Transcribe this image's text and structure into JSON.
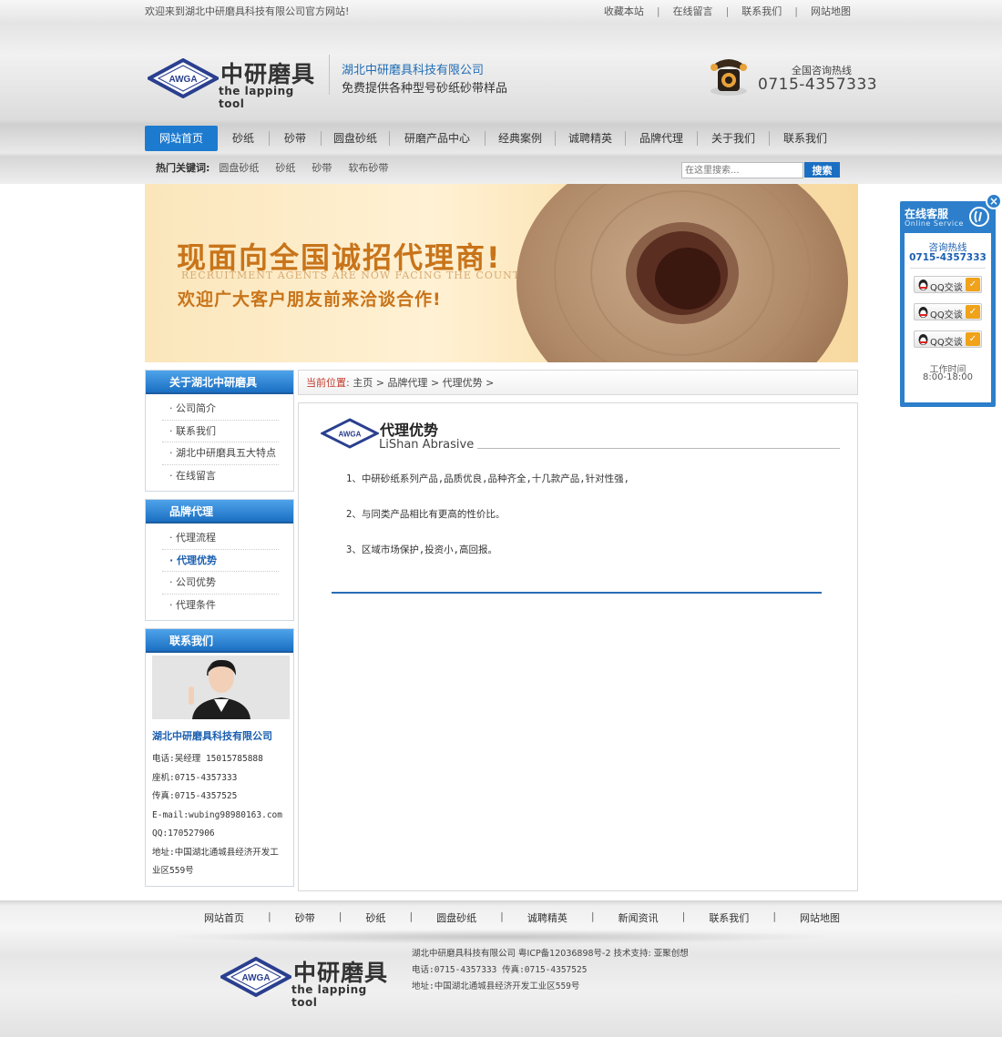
{
  "topbar": {
    "welcome": "欢迎来到湖北中研磨具科技有限公司官方网站!",
    "links": [
      "收藏本站",
      "在线留言",
      "联系我们",
      "网站地图"
    ]
  },
  "header": {
    "logo_badge": "AWGA",
    "logo_cn": "中研磨具",
    "logo_en": "the lapping tool",
    "company_name": "湖北中研磨具科技有限公司",
    "slogan": "免费提供各种型号砂纸砂带样品",
    "hotline_label": "全国咨询热线",
    "hotline_number": "0715-4357333"
  },
  "nav": {
    "items": [
      "网站首页",
      "砂纸",
      "砂带",
      "圆盘砂纸",
      "研磨产品中心",
      "经典案例",
      "诚聘精英",
      "品牌代理",
      "关于我们",
      "联系我们"
    ],
    "active_index": 0
  },
  "hotbar": {
    "label": "热门关键词:",
    "keywords": [
      "圆盘砂纸",
      "砂纸",
      "砂带",
      "软布砂带"
    ]
  },
  "search": {
    "placeholder": "在这里搜索...",
    "button": "搜索"
  },
  "banner": {
    "title": "现面向全国诚招代理商!",
    "english": "RECRUITMENT AGENTS ARE NOW FACING THE COUNTRY",
    "subtitle": "欢迎广大客户朋友前来洽谈合作!"
  },
  "sidebar": {
    "about": {
      "title": "关于湖北中研磨具",
      "items": [
        "公司简介",
        "联系我们",
        "湖北中研磨具五大特点",
        "在线留言"
      ]
    },
    "brand": {
      "title": "品牌代理",
      "items": [
        "代理流程",
        "代理优势",
        "公司优势",
        "代理条件"
      ],
      "active_index": 1
    },
    "contact": {
      "title": "联系我们",
      "company": "湖北中研磨具科技有限公司",
      "lines": [
        "电话:吴经理 15015785888",
        "座机:0715-4357333",
        "传真:0715-4357525",
        "E-mail:wubing98980163.com",
        "QQ:170527906",
        "地址:中国湖北通城县经济开发工",
        "业区559号"
      ]
    }
  },
  "breadcrumb": {
    "label": "当前位置:",
    "items": [
      "主页",
      "品牌代理",
      "代理优势"
    ]
  },
  "article": {
    "title": "代理优势",
    "subtitle": "LiShan Abrasive",
    "paragraphs": [
      "1、中研砂纸系列产品,品质优良,品种齐全,十几款产品,针对性强,",
      "2、与同类产品相比有更高的性价比。",
      "3、区域市场保护,投资小,高回报。"
    ]
  },
  "service": {
    "title": "在线客服",
    "title_en": "Online Service",
    "close": "×",
    "hotline_label": "咨询热线",
    "hotline": "0715-4357333",
    "qq_buttons": [
      "QQ交谈",
      "QQ交谈",
      "QQ交谈"
    ],
    "time_label": "工作时间",
    "time": "8:00-18:00"
  },
  "footer": {
    "nav": [
      "网站首页",
      "砂带",
      "砂纸",
      "圆盘砂纸",
      "诚聘精英",
      "新闻资讯",
      "联系我们",
      "网站地图"
    ],
    "company_line": "湖北中研磨具科技有限公司 粤ICP备12036898号-2 技术支持: 亚聚创想",
    "contact_line": "电话:0715-4357333 传真:0715-4357525",
    "address_line": "地址:中国湖北通城县经济开发工业区559号"
  },
  "colors": {
    "brand_blue": "#1d7bcf",
    "nav_active": "#1d7bcf",
    "banner_orange": "#c8741a",
    "breadcrumb_label": "#c0392b"
  }
}
